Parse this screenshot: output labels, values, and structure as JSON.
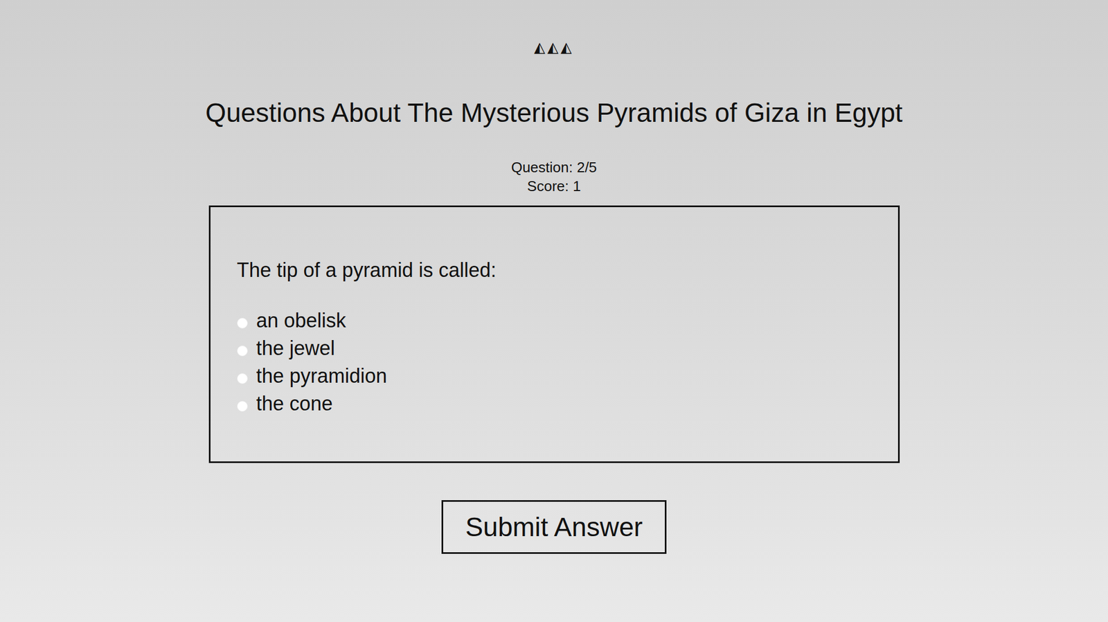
{
  "logo": "◭◭◭",
  "title": "Questions About The Mysterious Pyramids of Giza in Egypt",
  "progress": {
    "question": "Question: 2/5",
    "score": "Score: 1"
  },
  "quiz": {
    "question": "The tip of a pyramid is called:",
    "options": [
      {
        "label": "an obelisk",
        "selected": false
      },
      {
        "label": "the jewel",
        "selected": false
      },
      {
        "label": "the pyramidion",
        "selected": false
      },
      {
        "label": "the cone",
        "selected": false
      }
    ]
  },
  "buttons": [
    "Submit Answer"
  ]
}
